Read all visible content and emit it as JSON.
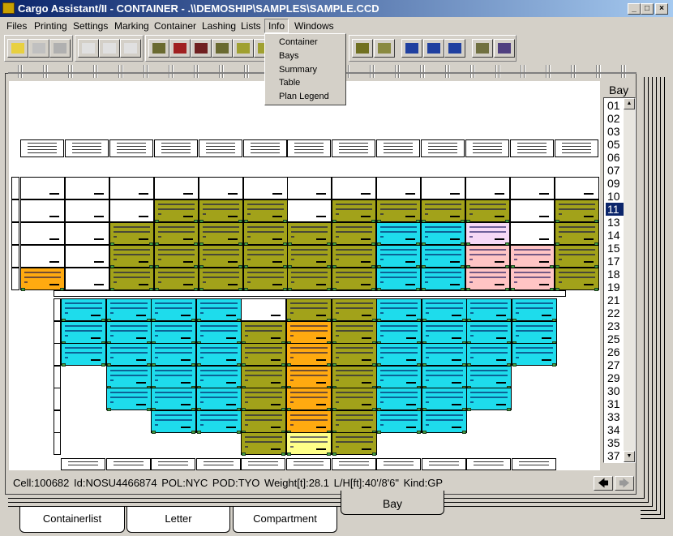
{
  "window": {
    "title": "Cargo Assistant/II - CONTAINER - .\\\\DEMOSHIP\\SAMPLES\\SAMPLE.CCD",
    "minimize": "_",
    "maximize": "□",
    "close": "×"
  },
  "menu": [
    "Files",
    "Printing",
    "Settings",
    "Marking",
    "Container",
    "Lashing",
    "Lists",
    "Info",
    "Windows"
  ],
  "info_menu": [
    "Container",
    "Bays",
    "Summary",
    "Table",
    "Plan Legend"
  ],
  "toolbar_icons": [
    "open-folder-icon",
    "print-preview-icon",
    "print-setup-icon",
    "container-mark-icon",
    "container-mark-add-icon",
    "container-mark-check-icon",
    "load-icon",
    "discharge-icon",
    "restow-icon",
    "containers-icon",
    "lashing-icon",
    "lashing-red-icon",
    "bay-view-icon",
    "block-view-icon",
    "ship-side-icon",
    "ship-top-icon",
    "ship-top2-icon",
    "hold-grid-icon",
    "hold-section-icon"
  ],
  "colors": {
    "olive": "#a2a21a",
    "cyan": "#1edcec",
    "orange": "#ffaa10",
    "yellow": "#ffff88",
    "pink": "#ffc4c4",
    "lavender": "#f6d8f6",
    "white": "#ffffff",
    "selection": "#0a246a"
  },
  "bay_plan": {
    "deck_columns": [
      [
        "white",
        "white",
        "white",
        "white",
        "orange"
      ],
      [
        "white",
        "white",
        "white",
        "white",
        "white"
      ],
      [
        "white",
        "white",
        "olive",
        "olive",
        "olive"
      ],
      [
        "white",
        "olive",
        "olive",
        "olive",
        "olive"
      ],
      [
        "white",
        "olive",
        "olive",
        "olive",
        "olive"
      ],
      [
        "white",
        "olive",
        "olive",
        "olive",
        "olive"
      ],
      [
        "white",
        "white",
        "olive",
        "olive",
        "olive"
      ],
      [
        "white",
        "olive",
        "olive",
        "olive",
        "olive"
      ],
      [
        "white",
        "olive",
        "cyan",
        "cyan",
        "cyan"
      ],
      [
        "white",
        "olive",
        "cyan",
        "cyan",
        "cyan"
      ],
      [
        "white",
        "olive",
        "lavender",
        "pink",
        "pink"
      ],
      [
        "white",
        "white",
        "white",
        "pink",
        "pink"
      ],
      [
        "white",
        "olive",
        "olive",
        "olive",
        "olive"
      ]
    ],
    "hold_columns": [
      [
        "cyan",
        "cyan",
        "cyan"
      ],
      [
        "cyan",
        "cyan",
        "cyan",
        "cyan",
        "cyan"
      ],
      [
        "cyan",
        "cyan",
        "cyan",
        "cyan",
        "cyan",
        "cyan"
      ],
      [
        "cyan",
        "cyan",
        "cyan",
        "cyan",
        "cyan",
        "cyan"
      ],
      [
        "white",
        "olive",
        "olive",
        "olive",
        "olive",
        "olive",
        "olive"
      ],
      [
        "olive",
        "orange",
        "orange",
        "orange",
        "orange",
        "orange",
        "yellow"
      ],
      [
        "olive",
        "olive",
        "olive",
        "olive",
        "olive",
        "olive",
        "olive"
      ],
      [
        "cyan",
        "cyan",
        "cyan",
        "cyan",
        "cyan",
        "cyan"
      ],
      [
        "cyan",
        "cyan",
        "cyan",
        "cyan",
        "cyan",
        "cyan"
      ],
      [
        "cyan",
        "cyan",
        "cyan",
        "cyan",
        "cyan"
      ],
      [
        "cyan",
        "cyan",
        "cyan"
      ]
    ]
  },
  "bay_panel": {
    "label": "Bay",
    "bays": [
      "01",
      "02",
      "03",
      "05",
      "06",
      "07",
      "09",
      "10",
      "11",
      "13",
      "14",
      "15",
      "17",
      "18",
      "19",
      "21",
      "22",
      "23",
      "25",
      "26",
      "27",
      "29",
      "30",
      "31",
      "33",
      "34",
      "35",
      "37"
    ],
    "selected": "11"
  },
  "status": {
    "text": "Cell:100682  Id:NOSU4466874  POL:NYC  POD:TYO  Weight[t]:28.1  L/H[ft]:40'/8'6\"  Kind:GP",
    "prev": "🡄",
    "next": "🡆"
  },
  "tabs": {
    "containerlist": "Containerlist",
    "letter": "Letter",
    "compartment": "Compartment",
    "bay": "Bay"
  }
}
